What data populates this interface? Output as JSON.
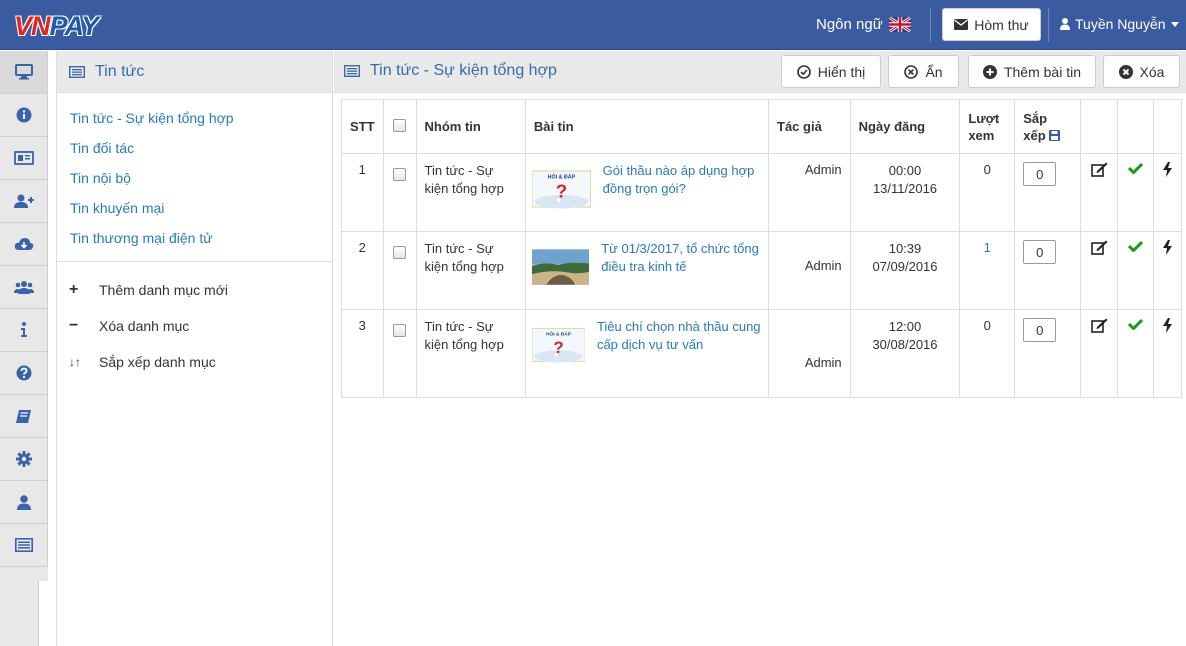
{
  "header": {
    "logo_vn": "VN",
    "logo_pay": "PAY",
    "language_label": "Ngôn ngữ",
    "inbox_label": "Hòm thư",
    "user_name": "Tuyền Nguyễn"
  },
  "icon_sidebar": [
    "desktop-icon",
    "info-circle-icon",
    "newspaper-icon",
    "user-plus-icon",
    "cloud-download-icon",
    "users-icon",
    "info-icon",
    "question-circle-icon",
    "book-icon",
    "gear-icon",
    "user-icon",
    "list-icon"
  ],
  "left_panel": {
    "title": "Tin tức",
    "categories": [
      "Tin tức - Sự kiện tổng hợp",
      "Tin đối tác",
      "Tin nội bộ",
      "Tin khuyến mại",
      "Tin thương mại điện tử"
    ],
    "actions": {
      "add": {
        "symbol": "+",
        "label": "Thêm danh mục mới"
      },
      "remove": {
        "symbol": "−",
        "label": "Xóa danh mục"
      },
      "sort": {
        "symbol": "↓↑",
        "label": "Sắp xếp danh mục"
      }
    }
  },
  "main": {
    "title": "Tin tức - Sự kiện tổng hợp",
    "buttons": {
      "show": "Hiển thị",
      "hide": "Ẩn",
      "add": "Thêm bài tin",
      "delete": "Xóa"
    }
  },
  "table": {
    "headers": {
      "stt": "STT",
      "group": "Nhóm tin",
      "article": "Bài tin",
      "author": "Tác giả",
      "date": "Ngày đăng",
      "views": "Lượt xem",
      "sort": "Sắp xếp"
    },
    "rows": [
      {
        "stt": "1",
        "group": "Tin tức - Sự kiện tổng hợp",
        "thumb_text": "HỎI & ĐÁP",
        "title": "Gói thầu nào áp dụng hợp đồng trọn gói?",
        "author": "Admin",
        "time": "00:00",
        "date": "13/11/2016",
        "views": "0",
        "order": "0"
      },
      {
        "stt": "2",
        "group": "Tin tức - Sự kiện tổng hợp",
        "thumb_text": "",
        "title": "Từ 01/3/2017, tổ chức tổng điều tra kinh tế",
        "author": "Admin",
        "time": "10:39",
        "date": "07/09/2016",
        "views": "1",
        "order": "0"
      },
      {
        "stt": "3",
        "group": "Tin tức - Sự kiện tổng hợp",
        "thumb_text": "HỎI & ĐÁP",
        "title": "Tiêu chí chọn nhà thầu cung cấp dịch vụ tư vấn",
        "author": "Admin",
        "time": "12:00",
        "date": "30/08/2016",
        "views": "0",
        "order": "0"
      }
    ]
  }
}
